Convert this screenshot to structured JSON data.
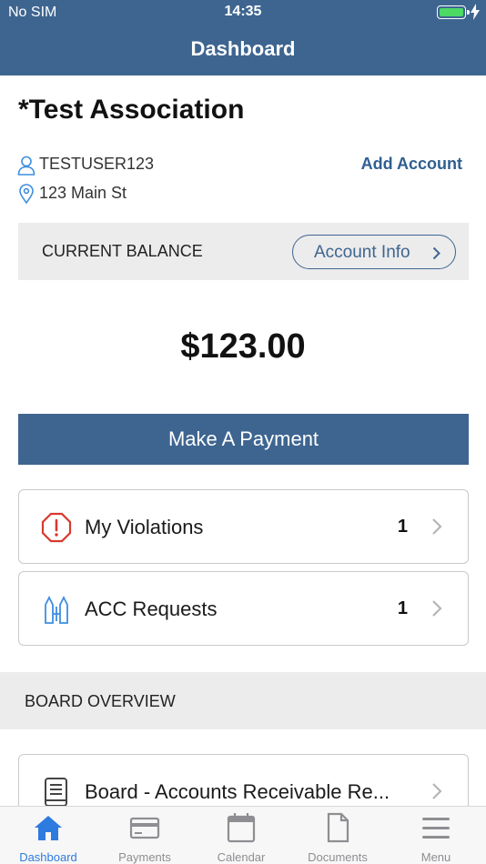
{
  "status_bar": {
    "carrier": "No SIM",
    "time": "14:35",
    "battery_level": 1.0
  },
  "nav": {
    "title": "Dashboard"
  },
  "account": {
    "association_name": "*Test Association",
    "username": "TESTUSER123",
    "address": "123 Main St",
    "add_account_label": "Add Account"
  },
  "balance": {
    "label": "CURRENT BALANCE",
    "account_info_label": "Account Info",
    "amount": "$123.00"
  },
  "payment": {
    "button_label": "Make A Payment"
  },
  "cards": [
    {
      "label": "My Violations",
      "count": "1",
      "icon": "alert-octagon-icon"
    },
    {
      "label": "ACC Requests",
      "count": "1",
      "icon": "architecture-request-icon"
    }
  ],
  "board_overview": {
    "header": "BOARD OVERVIEW",
    "items": [
      {
        "label": "Board - Accounts Receivable Re...",
        "icon": "book-icon"
      }
    ]
  },
  "tabs": [
    {
      "label": "Dashboard",
      "icon": "home-icon",
      "active": true
    },
    {
      "label": "Payments",
      "icon": "credit-card-icon",
      "active": false
    },
    {
      "label": "Calendar",
      "icon": "calendar-icon",
      "active": false
    },
    {
      "label": "Documents",
      "icon": "document-icon",
      "active": false
    },
    {
      "label": "Menu",
      "icon": "hamburger-menu-icon",
      "active": false
    }
  ],
  "colors": {
    "brand": "#3e6590",
    "link": "#2f5f91",
    "alert_red": "#d83a2f",
    "icon_blue": "#3d8ee0",
    "tab_active": "#2e7be0",
    "tab_inactive": "#8e8e93"
  }
}
